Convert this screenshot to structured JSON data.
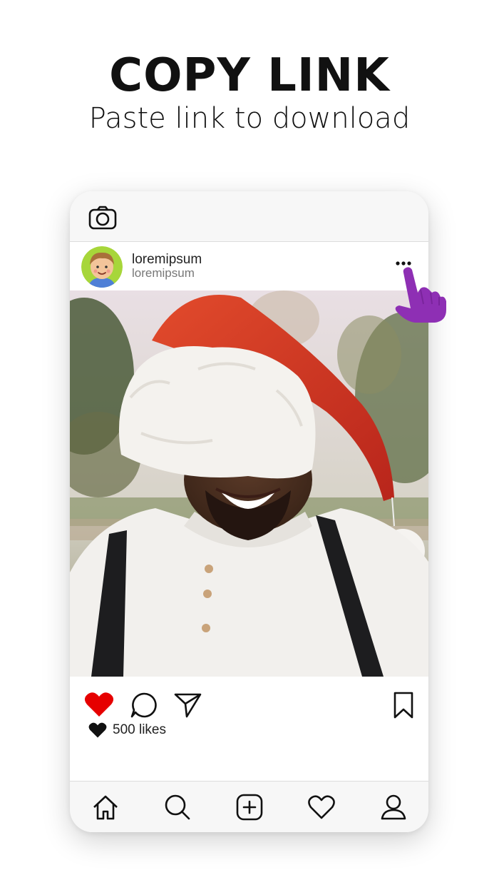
{
  "headline": "COPY LINK",
  "subheadline": "Paste link to download",
  "post": {
    "username": "loremipsum",
    "sublabel": "loremipsum",
    "likes": "500 likes",
    "liked_color": "#e60000"
  },
  "icons": {
    "camera": "camera-icon",
    "more": "more-dots-icon",
    "like": "heart-filled-icon",
    "comment": "comment-icon",
    "share": "send-icon",
    "save": "bookmark-icon",
    "nav": [
      "home-icon",
      "search-icon",
      "add-icon",
      "heart-icon",
      "profile-icon"
    ]
  },
  "colors": {
    "pointer_hand": "#8e2fb4",
    "hat_red": "#d63a22"
  }
}
